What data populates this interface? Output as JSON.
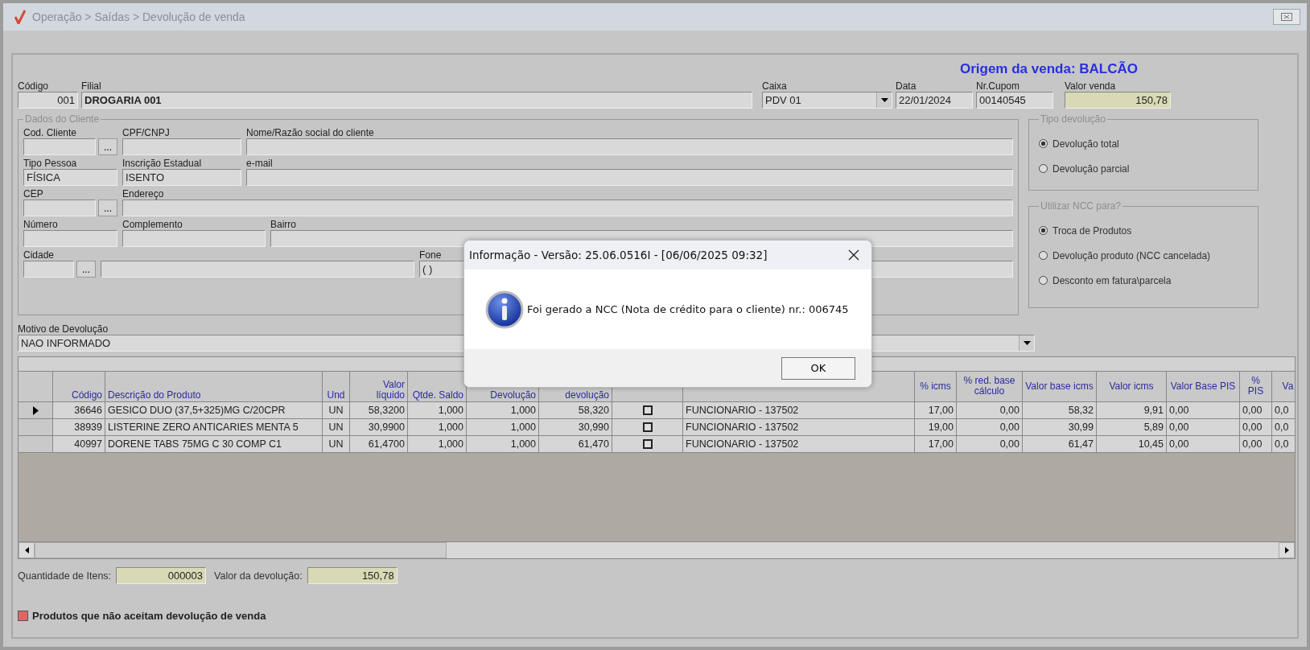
{
  "window": {
    "title": "Operação > Saídas > Devolução de venda"
  },
  "origin": "Origem da venda: BALCÃO",
  "header_fields": [
    {
      "kind": "number",
      "label": "Código",
      "value": "001"
    },
    {
      "kind": "text",
      "label": "Filial",
      "value": "DROGARIA 001",
      "bold": true
    },
    {
      "kind": "combo",
      "label": "Caixa",
      "value": "PDV 01"
    },
    {
      "kind": "text",
      "label": "Data",
      "value": "22/01/2024"
    },
    {
      "kind": "text",
      "label": "Nr.Cupom",
      "value": "00140545"
    },
    {
      "kind": "total",
      "label": "Valor venda",
      "value": "150,78"
    }
  ],
  "client": {
    "title": "Dados do Cliente",
    "rows": [
      [
        {
          "label": "Cod. Cliente",
          "button": "..."
        },
        {
          "label": "CPF/CNPJ"
        },
        {
          "label": "Nome/Razão social do cliente"
        }
      ],
      [
        {
          "label": "Tipo Pessoa",
          "value": "FÍSICA"
        },
        {
          "label": "Inscrição Estadual",
          "value": "ISENTO"
        },
        {
          "label": "e-mail"
        }
      ],
      [
        {
          "label": "CEP",
          "button": "..."
        },
        {
          "label": "Endereço"
        }
      ],
      [
        {
          "label": "Número"
        },
        {
          "label": "Complemento"
        },
        {
          "label": "Bairro"
        }
      ],
      [
        {
          "label": "Cidade",
          "button": "..."
        },
        {},
        {
          "label": "Fone",
          "value": "( )"
        }
      ]
    ]
  },
  "radio_groups": [
    {
      "title": "Tipo devolução",
      "options": [
        {
          "label": "Devolução total",
          "selected": true
        },
        {
          "label": "Devolução parcial",
          "selected": false
        }
      ]
    },
    {
      "title": "Utilizar NCC para?",
      "options": [
        {
          "label": "Troca de Produtos",
          "selected": true
        },
        {
          "label": "Devolução produto (NCC cancelada)",
          "selected": false
        },
        {
          "label": "Desconto em fatura\\parcela",
          "selected": false
        }
      ]
    }
  ],
  "reason": {
    "label": "Motivo de Devolução",
    "value": "NAO INFORMADO"
  },
  "table": {
    "columns": [
      {
        "label": "Código",
        "kind": "num"
      },
      {
        "label": "Descrição do Produto",
        "kind": "text"
      },
      {
        "label": "Und",
        "kind": "center"
      },
      {
        "label": "Valor líquido",
        "kind": "num"
      },
      {
        "label": "Qtde. Saldo",
        "kind": "num"
      },
      {
        "label": "Devolução",
        "kind": "num"
      },
      {
        "label": "devolução",
        "kind": "num"
      },
      {
        "kind": "check"
      },
      {
        "kind": "text"
      },
      {
        "label": "% icms",
        "kind": "num"
      },
      {
        "label": "% red. base cálculo",
        "kind": "num"
      },
      {
        "label": "Valor base icms",
        "kind": "num"
      },
      {
        "label": "Valor icms",
        "kind": "num"
      },
      {
        "label": "Valor Base PIS",
        "kind": "text"
      },
      {
        "label": "% PIS",
        "kind": "text"
      },
      {
        "label": "Va",
        "kind": "text"
      }
    ],
    "rows": [
      {
        "selected": true,
        "checked": false,
        "cells": [
          "36646",
          "GESICO DUO (37,5+325)MG C/20CPR",
          "UN",
          "58,3200",
          "1,000",
          "1,000",
          "58,320",
          "",
          "FUNCIONARIO - 137502",
          "17,00",
          "0,00",
          "58,32",
          "9,91",
          "0,00",
          "0,00",
          "0,0"
        ]
      },
      {
        "selected": false,
        "checked": false,
        "cells": [
          "38939",
          "LISTERINE ZERO ANTICARIES MENTA 5",
          "UN",
          "30,9900",
          "1,000",
          "1,000",
          "30,990",
          "",
          "FUNCIONARIO - 137502",
          "19,00",
          "0,00",
          "30,99",
          "5,89",
          "0,00",
          "0,00",
          "0,0"
        ]
      },
      {
        "selected": false,
        "checked": false,
        "cells": [
          "40997",
          "DORENE TABS 75MG C 30 COMP C1",
          "UN",
          "61,4700",
          "1,000",
          "1,000",
          "61,470",
          "",
          "FUNCIONARIO - 137502",
          "17,00",
          "0,00",
          "61,47",
          "10,45",
          "0,00",
          "0,00",
          "0,0"
        ]
      }
    ]
  },
  "totals": [
    {
      "label": "Quantidade de Itens:",
      "value": "000003"
    },
    {
      "label": "Valor da devolução:",
      "value": "150,78"
    }
  ],
  "legend": {
    "color": "#e06666",
    "text": "Produtos que não aceitam devolução de venda"
  },
  "dialog": {
    "title": "Informação - Versão: 25.06.0516I - [06/06/2025 09:32]",
    "message": "Foi gerado a NCC (Nota de crédito para o cliente) nr.: 006745",
    "button": "OK"
  }
}
